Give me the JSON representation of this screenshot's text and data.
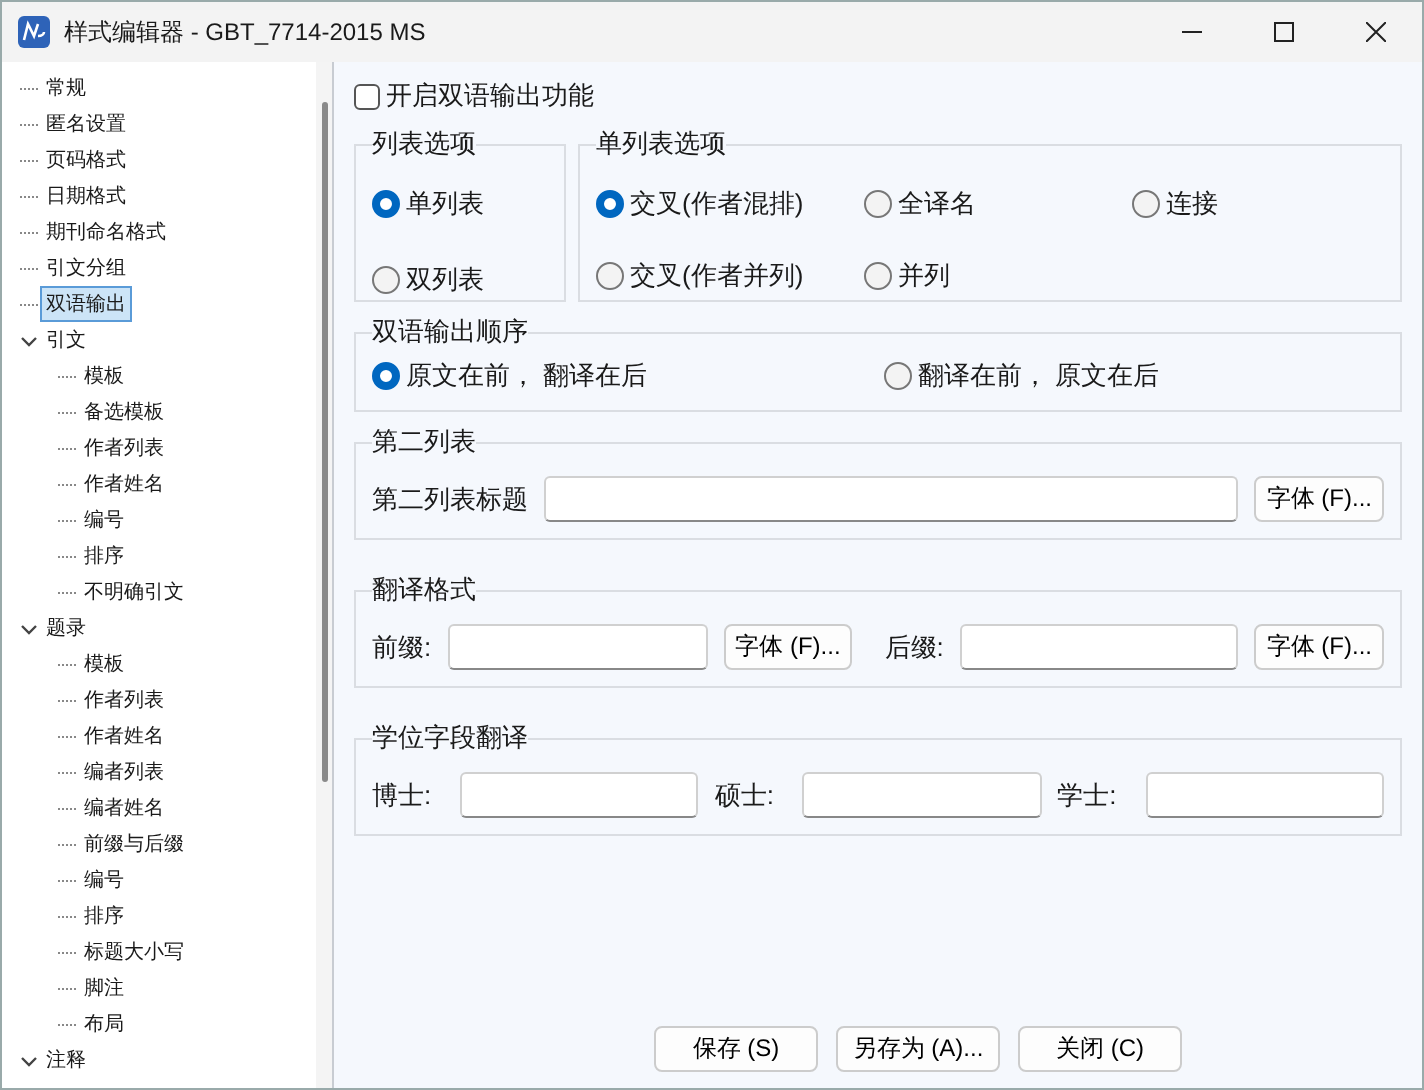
{
  "window": {
    "title": "样式编辑器 - GBT_7714-2015 MS"
  },
  "tree": [
    {
      "label": "常规",
      "selected": false
    },
    {
      "label": "匿名设置",
      "selected": false
    },
    {
      "label": "页码格式",
      "selected": false
    },
    {
      "label": "日期格式",
      "selected": false
    },
    {
      "label": "期刊命名格式",
      "selected": false
    },
    {
      "label": "引文分组",
      "selected": false
    },
    {
      "label": "双语输出",
      "selected": true
    },
    {
      "label": "引文",
      "selected": false,
      "expanded": true,
      "children": [
        {
          "label": "模板",
          "selected": false
        },
        {
          "label": "备选模板",
          "selected": false
        },
        {
          "label": "作者列表",
          "selected": false
        },
        {
          "label": "作者姓名",
          "selected": false
        },
        {
          "label": "编号",
          "selected": false
        },
        {
          "label": "排序",
          "selected": false
        },
        {
          "label": "不明确引文",
          "selected": false
        }
      ]
    },
    {
      "label": "题录",
      "selected": false,
      "expanded": true,
      "children": [
        {
          "label": "模板",
          "selected": false
        },
        {
          "label": "作者列表",
          "selected": false
        },
        {
          "label": "作者姓名",
          "selected": false
        },
        {
          "label": "编者列表",
          "selected": false
        },
        {
          "label": "编者姓名",
          "selected": false
        },
        {
          "label": "前缀与后缀",
          "selected": false
        },
        {
          "label": "编号",
          "selected": false
        },
        {
          "label": "排序",
          "selected": false
        },
        {
          "label": "标题大小写",
          "selected": false
        },
        {
          "label": "脚注",
          "selected": false
        },
        {
          "label": "布局",
          "selected": false
        }
      ]
    },
    {
      "label": "注释",
      "selected": false,
      "expanded": true
    }
  ],
  "enable_bilingual": {
    "label": "开启双语输出功能",
    "checked": false
  },
  "list_options": {
    "title": "列表选项",
    "options": [
      {
        "label": "单列表",
        "selected": true
      },
      {
        "label": "双列表",
        "selected": false
      }
    ]
  },
  "single_list_options": {
    "title": "单列表选项",
    "options": [
      {
        "label": "交叉(作者混排)",
        "selected": true
      },
      {
        "label": "全译名",
        "selected": false
      },
      {
        "label": "连接",
        "selected": false
      },
      {
        "label": "交叉(作者并列)",
        "selected": false
      },
      {
        "label": "并列",
        "selected": false
      }
    ]
  },
  "order": {
    "title": "双语输出顺序",
    "options": [
      {
        "label": "原文在前， 翻译在后",
        "selected": true
      },
      {
        "label": "翻译在前， 原文在后",
        "selected": false
      }
    ]
  },
  "second_list": {
    "title": "第二列表",
    "label": "第二列表标题",
    "font_button": "字体 (F)..."
  },
  "translation_format": {
    "title": "翻译格式",
    "prefix_label": "前缀:",
    "prefix_font_button": "字体 (F)...",
    "suffix_label": "后缀:",
    "suffix_font_button": "字体 (F)..."
  },
  "degree": {
    "title": "学位字段翻译",
    "fields": [
      {
        "label": "博士:"
      },
      {
        "label": "硕士:"
      },
      {
        "label": "学士:"
      }
    ]
  },
  "buttons": [
    "保存 (S)",
    "另存为 (A)...",
    "关闭 (C)"
  ]
}
